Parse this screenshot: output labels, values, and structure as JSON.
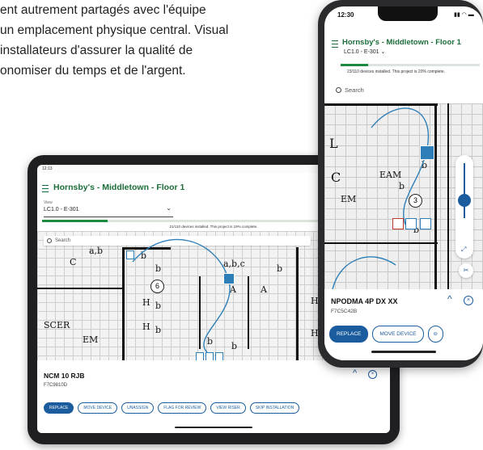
{
  "intro": {
    "line1": "ent autrement partagés avec l'équipe",
    "line2": "un emplacement physique central. Visual",
    "line3": "installateurs d'assurer la qualité de",
    "line4": "onomiser du temps et de l'argent."
  },
  "tablet": {
    "status_time": "12:13",
    "title": "Hornsby's - Middletown - Floor 1",
    "view_label": "View",
    "view_value": "LC1.0 - E-301",
    "progress_text": "21/110 devices installed. This project is 19% complete.",
    "progress_fraction": 0.19,
    "search_placeholder": "Search",
    "map": {
      "labels": [
        "C",
        "a,b",
        "b",
        "b",
        "6",
        "a,b,c",
        "A",
        "A",
        "H",
        "b",
        "H",
        "b",
        "EM",
        "SCER",
        "H",
        "b",
        "H",
        "b",
        "b",
        "b",
        "b",
        "b"
      ]
    },
    "device_name": "NCM 10 RJB",
    "device_id": "F7C9810D",
    "actions": [
      "REPLACE",
      "MOVE DEVICE",
      "UNASSIGN",
      "FLAG FOR REVIEW",
      "VIEW RISER",
      "SKIP INSTALLATION"
    ]
  },
  "phone": {
    "status_time": "12:30",
    "title": "Hornsby's - Middletown - Floor 1",
    "view_value": "LC1.0 - E-301",
    "progress_text": "23/110 devices installed. This project is 20% complete.",
    "progress_fraction": 0.2,
    "search_placeholder": "Search",
    "map": {
      "labels": [
        "L",
        "C",
        "EAM",
        "EM",
        "3",
        "b",
        "b",
        "b"
      ]
    },
    "device_name": "NPODMA 4P DX XX",
    "device_id": "F7C5C42B",
    "actions": [
      "REPLACE",
      "MOVE DEVICE"
    ]
  },
  "colors": {
    "brand_green": "#1b6e3a",
    "progress_green": "#1b8a3f",
    "action_blue": "#1b5c9e"
  }
}
